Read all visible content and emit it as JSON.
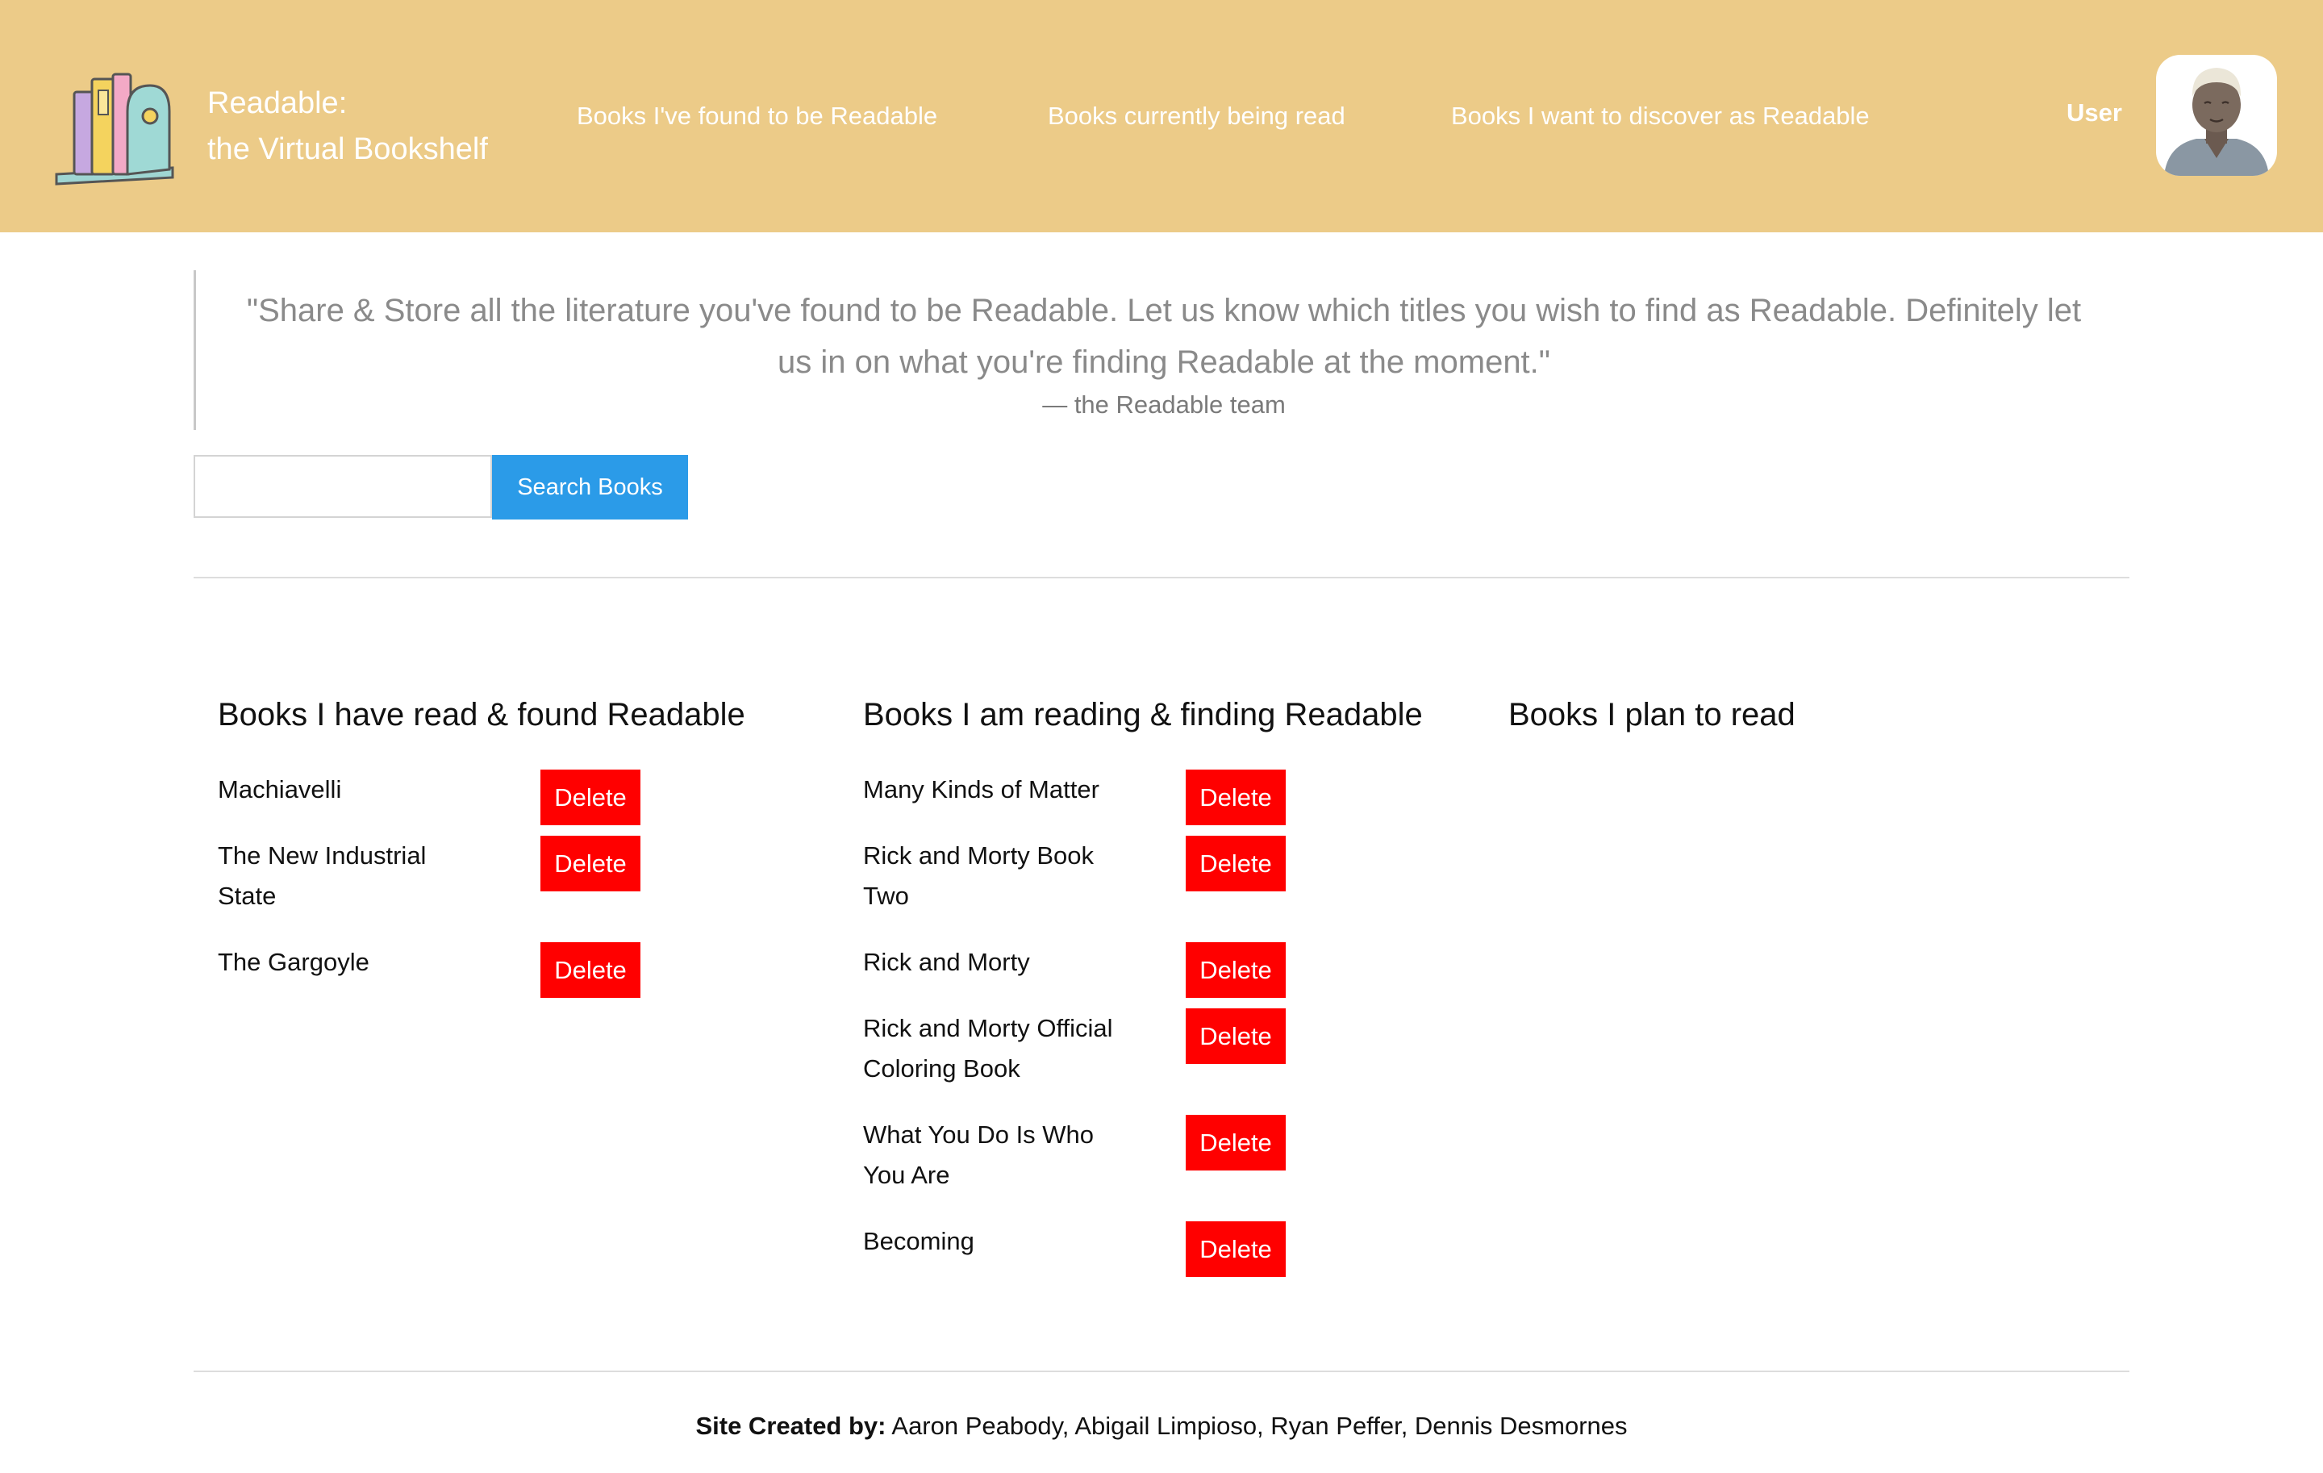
{
  "app": {
    "brand_line1": "Readable:",
    "brand_line2": "the Virtual Bookshelf"
  },
  "nav": {
    "found": "Books I've found to be Readable",
    "current": "Books currently being read",
    "discover": "Books I want to discover as Readable"
  },
  "user": {
    "label": "User",
    "avatar_icon": "user-avatar-icon"
  },
  "quote": {
    "text": "\"Share & Store all the literature you've found to be Readable. Let us know which titles you wish to find as Readable. Definitely let us in on what you're finding Readable at the moment.\"",
    "author": "—  the Readable team"
  },
  "search": {
    "placeholder": "",
    "value": "",
    "button_label": "Search Books"
  },
  "columns": {
    "read": {
      "title": "Books I have read & found Readable",
      "books": [
        {
          "title": "Machiavelli",
          "delete_label": "Delete"
        },
        {
          "title": "The New Industrial State",
          "delete_label": "Delete"
        },
        {
          "title": "The Gargoyle",
          "delete_label": "Delete"
        }
      ]
    },
    "reading": {
      "title": "Books I am reading & finding Readable",
      "books": [
        {
          "title": "Many Kinds of Matter",
          "delete_label": "Delete"
        },
        {
          "title": "Rick and Morty Book Two",
          "delete_label": "Delete"
        },
        {
          "title": "Rick and Morty",
          "delete_label": "Delete"
        },
        {
          "title": "Rick and Morty Official Coloring Book",
          "delete_label": "Delete"
        },
        {
          "title": "What You Do Is Who You Are",
          "delete_label": "Delete"
        },
        {
          "title": "Becoming",
          "delete_label": "Delete"
        }
      ]
    },
    "plan": {
      "title": "Books I plan to read",
      "books": []
    }
  },
  "footer": {
    "label": "Site Created by:",
    "names": "Aaron Peabody, Abigail Limpioso, Ryan Peffer, Dennis Desmornes"
  },
  "colors": {
    "header_bg": "#eccb88",
    "search_button": "#2b9be8",
    "delete_button": "#ff0000"
  }
}
